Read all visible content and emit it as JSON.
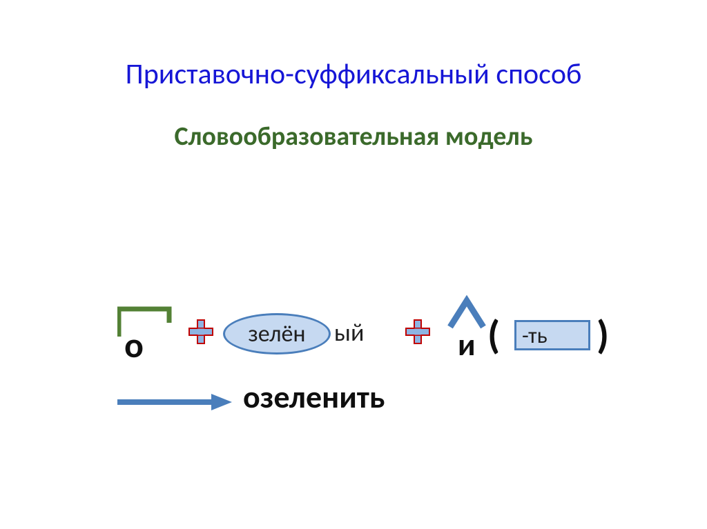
{
  "title": "Приставочно-суффиксальный способ",
  "subtitle": "Словообразовательная модель",
  "model": {
    "prefix": "о",
    "root": "зелён",
    "root_ending": "ый",
    "suffix": "и",
    "paren_open": "(",
    "paren_close": ")",
    "infinitive_ending": "-ть",
    "result": "озеленить"
  },
  "colors": {
    "title": "#1616d6",
    "subtitle": "#3b6a2b",
    "shape_fill": "#c6d9f1",
    "shape_stroke": "#4a7ebb",
    "arrow": "#4a7ebb",
    "bracket": "#538135",
    "plus_red": "#c00000",
    "text": "#0f0f0f"
  }
}
